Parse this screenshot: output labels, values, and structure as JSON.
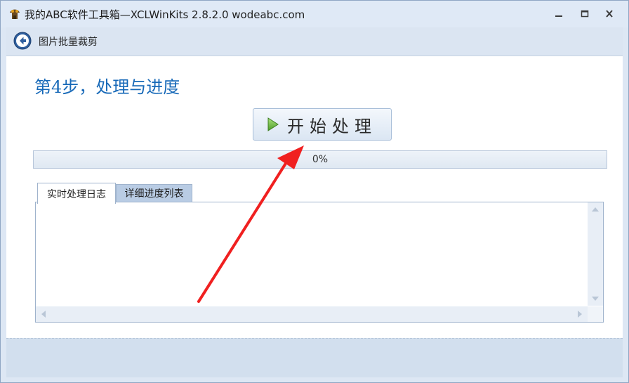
{
  "window": {
    "title": "我的ABC软件工具箱—XCLWinKits 2.8.2.0  wodeabc.com"
  },
  "header": {
    "back_icon": "back-arrow-icon",
    "title": "图片批量裁剪"
  },
  "main": {
    "step_title": "第4步，处理与进度",
    "start_button": {
      "label": "开始处理",
      "icon": "play-icon"
    },
    "progress": {
      "value": 0,
      "text": "0%"
    },
    "tabs": [
      {
        "label": "实时处理日志",
        "active": true
      },
      {
        "label": "详细进度列表",
        "active": false
      }
    ]
  },
  "colors": {
    "accent": "#1769b8",
    "annotation_arrow": "#f02020"
  }
}
